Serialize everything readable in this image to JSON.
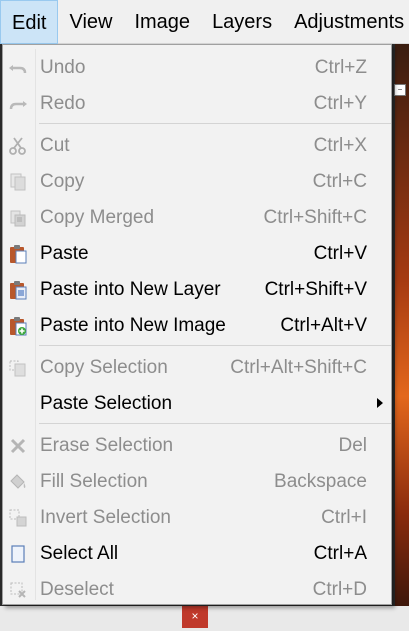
{
  "menubar": {
    "items": [
      "Edit",
      "View",
      "Image",
      "Layers",
      "Adjustments"
    ]
  },
  "edit_menu": {
    "undo": {
      "label": "Undo",
      "shortcut": "Ctrl+Z"
    },
    "redo": {
      "label": "Redo",
      "shortcut": "Ctrl+Y"
    },
    "cut": {
      "label": "Cut",
      "shortcut": "Ctrl+X"
    },
    "copy": {
      "label": "Copy",
      "shortcut": "Ctrl+C"
    },
    "copy_merged": {
      "label": "Copy Merged",
      "shortcut": "Ctrl+Shift+C"
    },
    "paste": {
      "label": "Paste",
      "shortcut": "Ctrl+V"
    },
    "paste_new_layer": {
      "label": "Paste into New Layer",
      "shortcut": "Ctrl+Shift+V"
    },
    "paste_new_image": {
      "label": "Paste into New Image",
      "shortcut": "Ctrl+Alt+V"
    },
    "copy_selection": {
      "label": "Copy Selection",
      "shortcut": "Ctrl+Alt+Shift+C"
    },
    "paste_selection": {
      "label": "Paste Selection"
    },
    "erase_selection": {
      "label": "Erase Selection",
      "shortcut": "Del"
    },
    "fill_selection": {
      "label": "Fill Selection",
      "shortcut": "Backspace"
    },
    "invert_selection": {
      "label": "Invert Selection",
      "shortcut": "Ctrl+I"
    },
    "select_all": {
      "label": "Select All",
      "shortcut": "Ctrl+A"
    },
    "deselect": {
      "label": "Deselect",
      "shortcut": "Ctrl+D"
    }
  },
  "background": {
    "close_glyph": "×",
    "mini_glyph": "−"
  },
  "colors": {
    "menubar_active_bg": "#cce4f7",
    "disabled_text": "#8d8d8d",
    "enabled_text": "#000000",
    "paste_icon_accent": "#c0502a",
    "close_button": "#c0392b"
  },
  "icons": {
    "undo": "undo-arrow-icon",
    "redo": "redo-arrow-icon",
    "cut": "scissors-icon",
    "copy": "copy-pages-icon",
    "copy_merged": "copy-merged-icon",
    "paste": "clipboard-icon",
    "paste_new_layer": "clipboard-layer-icon",
    "paste_new_image": "clipboard-image-icon",
    "copy_selection": "copy-selection-icon",
    "erase_selection": "erase-x-icon",
    "fill_selection": "paint-bucket-icon",
    "invert_selection": "invert-selection-icon",
    "select_all": "select-all-page-icon",
    "deselect": "deselect-icon"
  }
}
